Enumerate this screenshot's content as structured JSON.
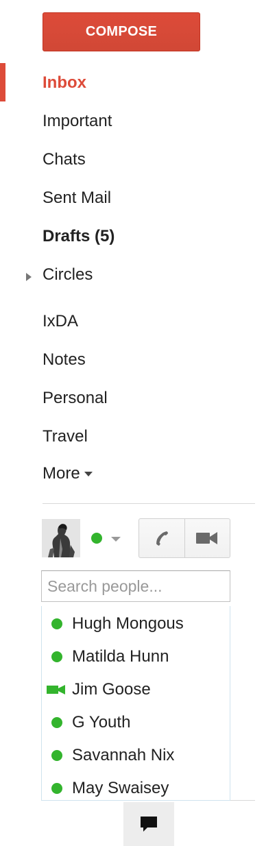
{
  "compose": {
    "label": "COMPOSE"
  },
  "nav": {
    "inbox": "Inbox",
    "important": "Important",
    "chats": "Chats",
    "sent": "Sent Mail",
    "drafts": "Drafts (5)",
    "circles": "Circles",
    "ixda": "IxDA",
    "notes": "Notes",
    "personal": "Personal",
    "travel": "Travel",
    "more": "More"
  },
  "chat": {
    "status": "available",
    "status_color": "#33b42d",
    "call_icon": "phone-icon",
    "video_icon": "video-camera-icon",
    "search_placeholder": "Search people...",
    "contacts": [
      {
        "name": "Hugh Mongous",
        "status": "available"
      },
      {
        "name": "Matilda Hunn",
        "status": "available"
      },
      {
        "name": "Jim Goose",
        "status": "video"
      },
      {
        "name": "G Youth",
        "status": "available"
      },
      {
        "name": "Savannah Nix",
        "status": "available"
      },
      {
        "name": "May Swaisey",
        "status": "available"
      }
    ]
  },
  "colors": {
    "accent": "#dd4b39",
    "online": "#33b42d"
  }
}
